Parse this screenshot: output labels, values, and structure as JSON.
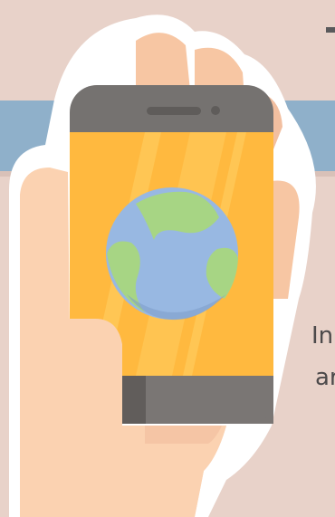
{
  "caption": {
    "line1": "In",
    "line2": "ar"
  },
  "illustration": {
    "icon": "hand-holding-smartphone-with-globe"
  },
  "colors": {
    "background": "#e8d2c9",
    "band": "#8fb0ca",
    "skin": "#fbd2b1",
    "skin_shadow": "#f2bfa0",
    "outline": "#ffffff",
    "phone_frame": "#757270",
    "screen": "#ffb93f",
    "globe_water": "#98b8e2",
    "globe_land": "#a7d584"
  }
}
